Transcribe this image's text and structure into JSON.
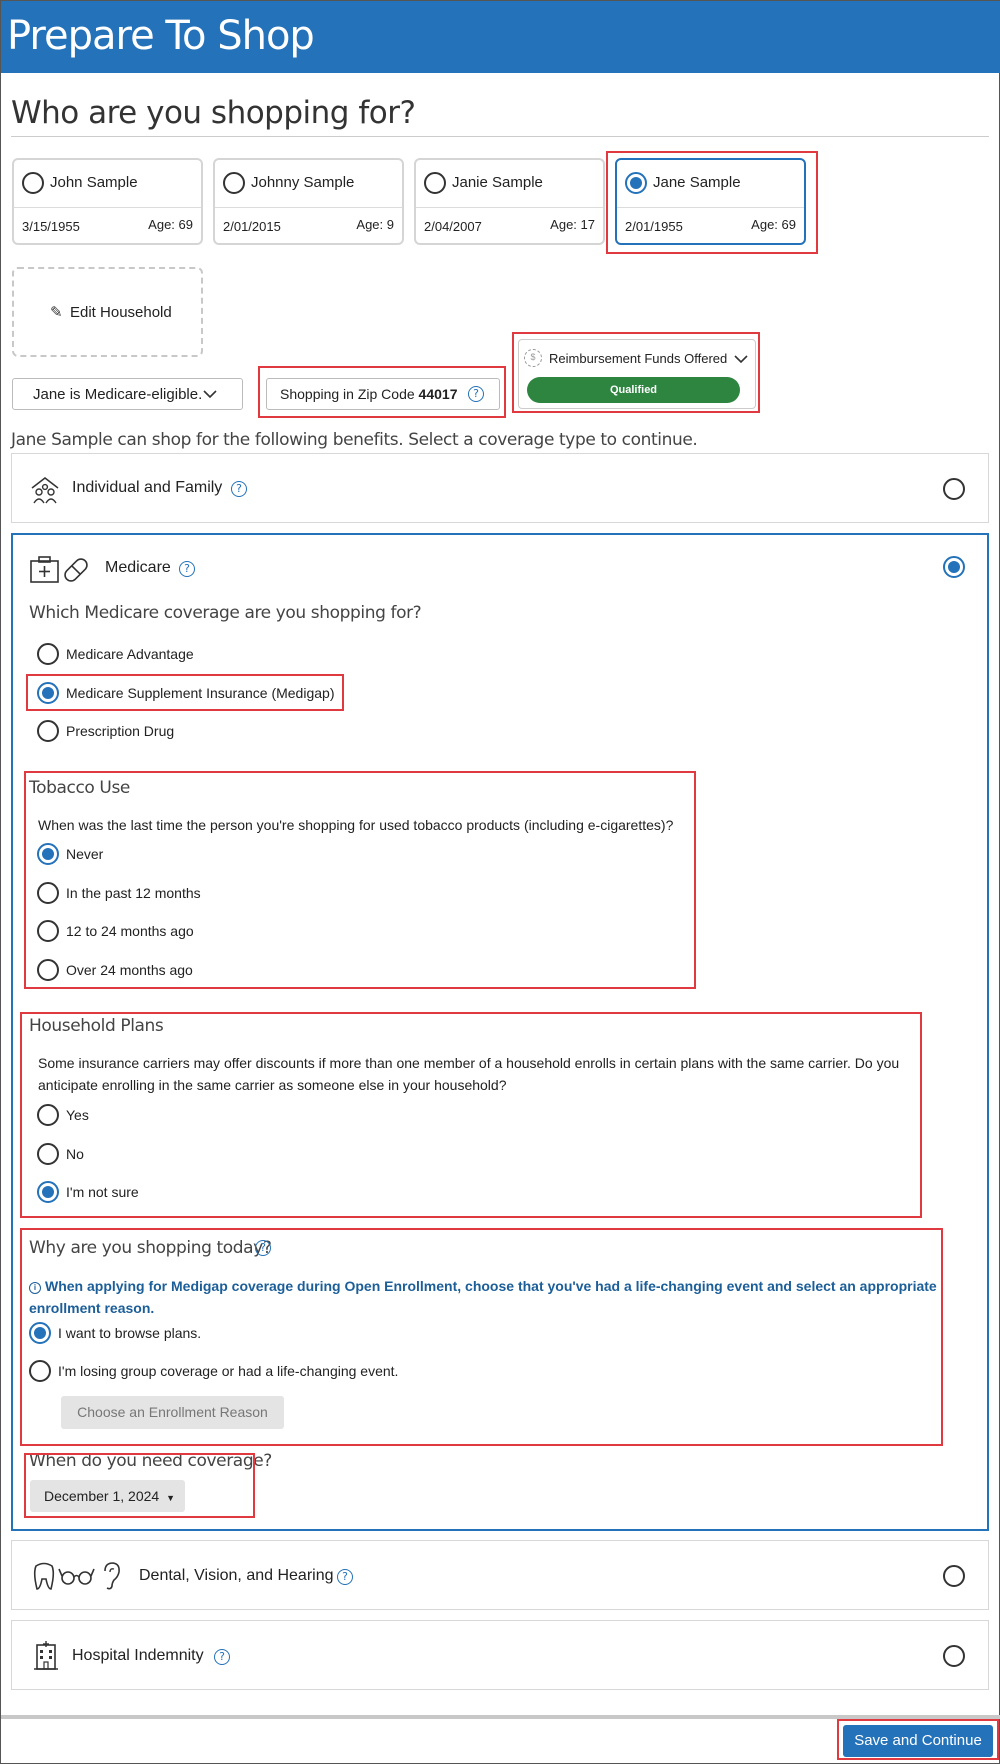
{
  "header": {
    "title": "Prepare To Shop"
  },
  "page_title": "Who are you shopping for?",
  "people": [
    {
      "name": "John Sample",
      "dob": "3/15/1955",
      "age": "Age: 69",
      "selected": false
    },
    {
      "name": "Johnny Sample",
      "dob": "2/01/2015",
      "age": "Age: 9",
      "selected": false
    },
    {
      "name": "Janie Sample",
      "dob": "2/04/2007",
      "age": "Age: 17",
      "selected": false
    },
    {
      "name": "Jane Sample",
      "dob": "2/01/1955",
      "age": "Age: 69",
      "selected": true
    }
  ],
  "edit_household": "Edit Household",
  "eligibility": "Jane is Medicare-eligible.",
  "zip": {
    "label": "Shopping in Zip Code",
    "code": "44017"
  },
  "reimbursement": {
    "label": "Reimbursement Funds Offered",
    "status": "Qualified",
    "status_color": "#2d8540"
  },
  "intro": "Jane Sample can shop for the following benefits. Select a coverage type to continue.",
  "coverage_types": {
    "individual": {
      "label": "Individual and Family",
      "selected": false,
      "icon": "family-icon"
    },
    "medicare": {
      "label": "Medicare",
      "selected": true,
      "icon": "medical-kit-pill-icon"
    },
    "dental": {
      "label": "Dental, Vision, and Hearing",
      "selected": false,
      "icon": "tooth-glasses-ear-icon"
    },
    "hospital": {
      "label": "Hospital Indemnity",
      "selected": false,
      "icon": "hospital-building-icon"
    }
  },
  "medicare": {
    "question": "Which Medicare coverage are you shopping for?",
    "options": [
      "Medicare Advantage",
      "Medicare Supplement Insurance (Medigap)",
      "Prescription Drug"
    ],
    "selected_index": 1
  },
  "tobacco": {
    "heading": "Tobacco Use",
    "question": "When was the last time the person you're shopping for used tobacco products (including e-cigarettes)?",
    "options": [
      "Never",
      "In the past 12 months",
      "12 to 24 months ago",
      "Over 24 months ago"
    ],
    "selected_index": 0
  },
  "household_plans": {
    "heading": "Household Plans",
    "question": "Some insurance carriers may offer discounts if more than one member of a household enrolls in certain plans with the same carrier. Do you anticipate enrolling in the same carrier as someone else in your household?",
    "options": [
      "Yes",
      "No",
      "I'm not sure"
    ],
    "selected_index": 2
  },
  "why_shopping": {
    "heading": "Why are you shopping today?",
    "notice": "When applying for Medigap coverage during Open Enrollment, choose that you've had a life-changing event and select an appropriate enrollment reason.",
    "options": [
      "I want to browse plans.",
      "I'm losing group coverage or had a life-changing event."
    ],
    "selected_index": 0,
    "reason_button": "Choose an Enrollment Reason"
  },
  "coverage_date": {
    "heading": "When do you need coverage?",
    "value": "December 1, 2024"
  },
  "save_button": "Save and Continue",
  "colors": {
    "brand": "#2472b9",
    "highlight": "#e0393f",
    "success": "#2d8540"
  }
}
